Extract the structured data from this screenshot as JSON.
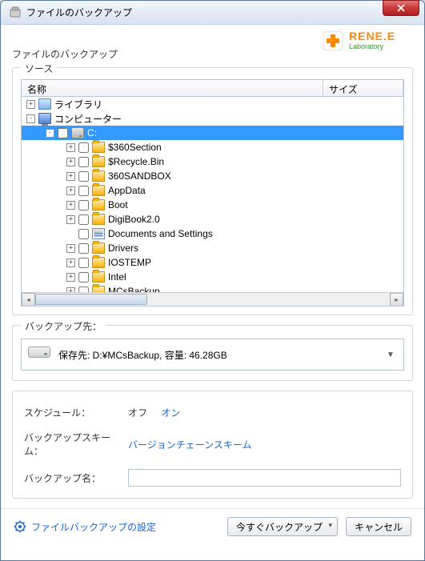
{
  "window": {
    "title": "ファイルのバックアップ"
  },
  "brand": {
    "name": "RENE.E",
    "sub": "Laboratory"
  },
  "page": {
    "title": "ファイルのバックアップ"
  },
  "source": {
    "legend": "ソース",
    "cols": {
      "name": "名称",
      "size": "サイズ"
    },
    "root": {
      "libraries": "ライブラリ",
      "computer": "コンピューター",
      "drive_c": "C:"
    },
    "items": [
      {
        "label": "$360Section",
        "icon": "folder",
        "exp": "+"
      },
      {
        "label": "$Recycle.Bin",
        "icon": "folder",
        "exp": "+"
      },
      {
        "label": "360SANDBOX",
        "icon": "folder",
        "exp": "+"
      },
      {
        "label": "AppData",
        "icon": "folder",
        "exp": "+"
      },
      {
        "label": "Boot",
        "icon": "folder",
        "exp": "+"
      },
      {
        "label": "DigiBook2.0",
        "icon": "folder",
        "exp": "+"
      },
      {
        "label": "Documents and Settings",
        "icon": "doc",
        "exp": ""
      },
      {
        "label": "Drivers",
        "icon": "folder",
        "exp": "+"
      },
      {
        "label": "IOSTEMP",
        "icon": "folder",
        "exp": "+"
      },
      {
        "label": "Intel",
        "icon": "folder",
        "exp": "+"
      },
      {
        "label": "MCsBackup",
        "icon": "folder",
        "exp": "+"
      }
    ]
  },
  "destination": {
    "legend": "バックアップ先：",
    "text": "保存先: D:¥MCsBackup, 容量: 46.28GB"
  },
  "sched": {
    "schedule_label": "スケジュール：",
    "off": "オフ",
    "on": "オン",
    "scheme_label": "バックアップスキーム：",
    "scheme_value": "バージョンチェーンスキーム",
    "name_label": "バックアップ名：",
    "name_value": ""
  },
  "footer": {
    "settings": "ファイルバックアップの設定",
    "backup_now": "今すぐバックアップ",
    "cancel": "キャンセル"
  }
}
